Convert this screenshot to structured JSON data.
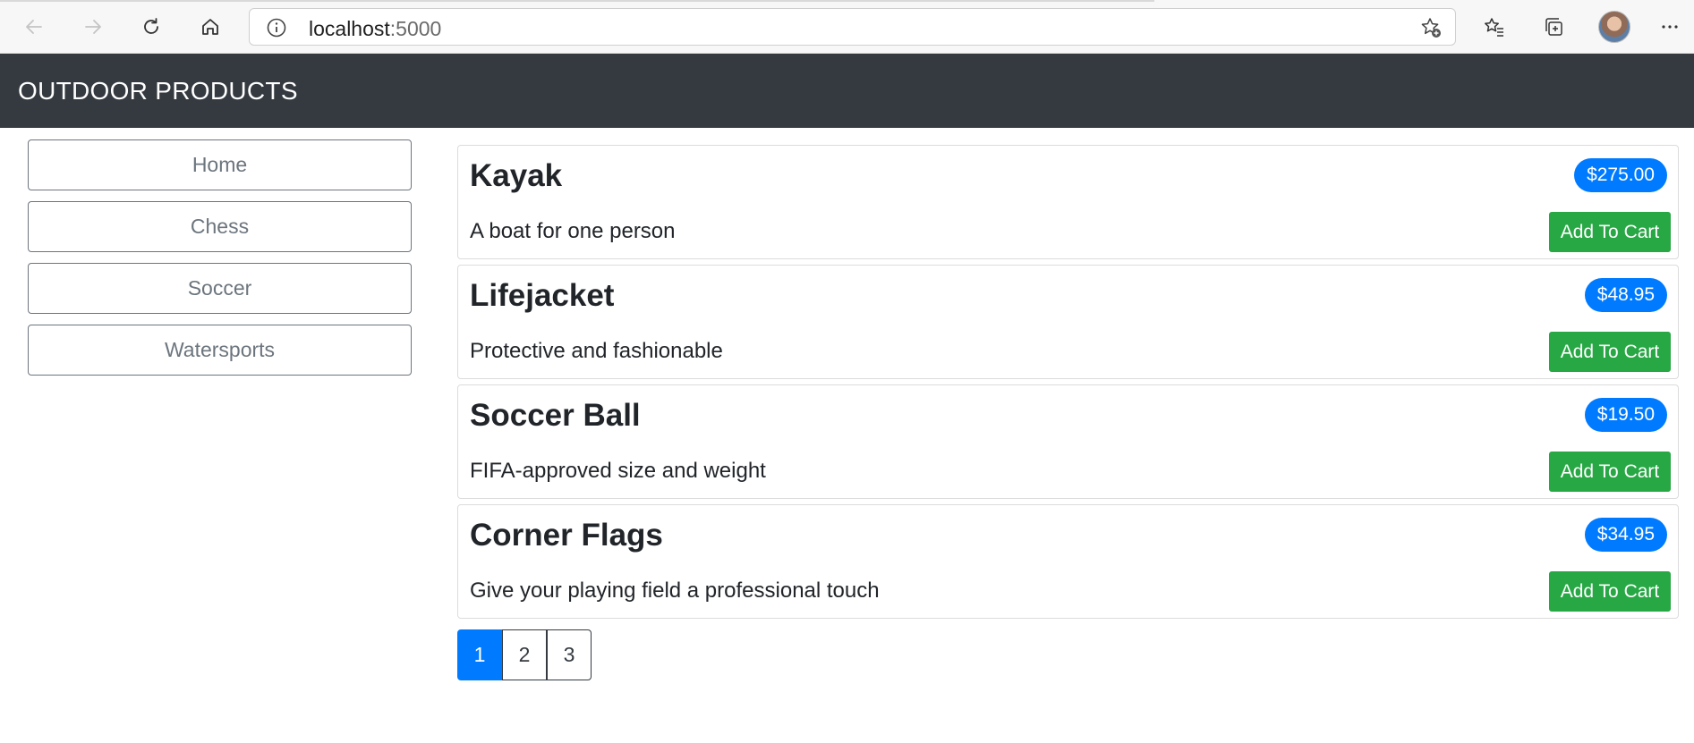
{
  "browser": {
    "url_host": "localhost",
    "url_port": ":5000"
  },
  "navbar": {
    "brand": "OUTDOOR PRODUCTS",
    "background": "#343a40"
  },
  "categories": [
    {
      "label": "Home"
    },
    {
      "label": "Chess"
    },
    {
      "label": "Soccer"
    },
    {
      "label": "Watersports"
    }
  ],
  "products": [
    {
      "name": "Kayak",
      "description": "A boat for one person",
      "price": "$275.00",
      "cart_label": "Add To Cart"
    },
    {
      "name": "Lifejacket",
      "description": "Protective and fashionable",
      "price": "$48.95",
      "cart_label": "Add To Cart"
    },
    {
      "name": "Soccer Ball",
      "description": "FIFA-approved size and weight",
      "price": "$19.50",
      "cart_label": "Add To Cart"
    },
    {
      "name": "Corner Flags",
      "description": "Give your playing field a professional touch",
      "price": "$34.95",
      "cart_label": "Add To Cart"
    }
  ],
  "pagination": {
    "pages": [
      "1",
      "2",
      "3"
    ],
    "current": "1"
  },
  "colors": {
    "price_badge": "#007bff",
    "cart_button": "#28a745",
    "active_page": "#007bff",
    "category_border": "#6c757d"
  },
  "icons": {
    "back": "back-arrow-icon",
    "forward": "forward-arrow-icon",
    "refresh": "refresh-icon",
    "home": "home-icon",
    "info": "info-icon",
    "favorite_add": "star-plus-icon",
    "favorites": "favorites-icon",
    "collections": "collections-icon",
    "more": "more-icon"
  }
}
